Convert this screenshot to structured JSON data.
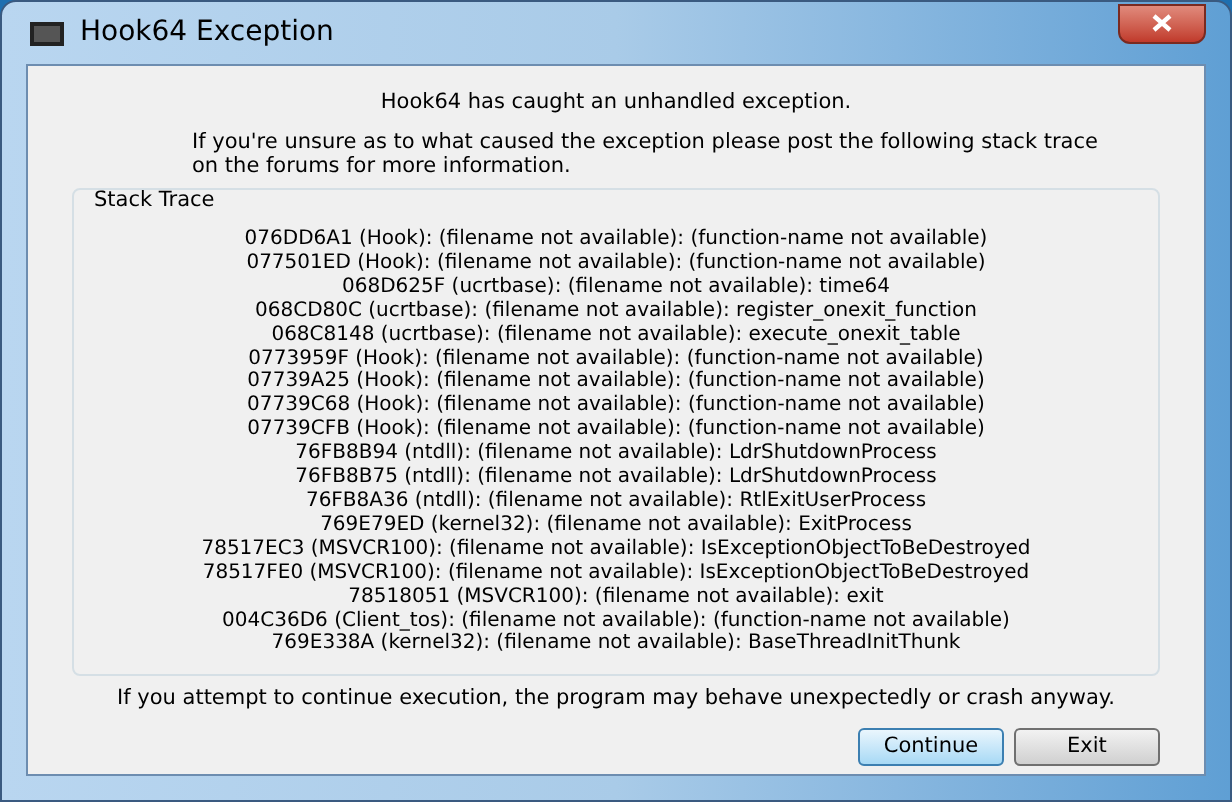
{
  "window": {
    "title": "Hook64 Exception"
  },
  "heading": "Hook64 has caught an unhandled exception.",
  "instructions": [
    "If you're unsure as to what caused the exception please post the following stack trace",
    "on the forums for more information."
  ],
  "stack_trace": {
    "label": "Stack Trace",
    "lines": [
      "076DD6A1 (Hook): (filename not available): (function-name not available)",
      "077501ED (Hook): (filename not available): (function-name not available)",
      "068D625F (ucrtbase): (filename not available): time64",
      "068CD80C (ucrtbase): (filename not available): register_onexit_function",
      "068C8148 (ucrtbase): (filename not available): execute_onexit_table",
      "0773959F (Hook): (filename not available): (function-name not available)",
      "07739A25 (Hook): (filename not available): (function-name not available)",
      "07739C68 (Hook): (filename not available): (function-name not available)",
      "07739CFB (Hook): (filename not available): (function-name not available)",
      "76FB8B94 (ntdll): (filename not available): LdrShutdownProcess",
      "76FB8B75 (ntdll): (filename not available): LdrShutdownProcess",
      "76FB8A36 (ntdll): (filename not available): RtlExitUserProcess",
      "769E79ED (kernel32): (filename not available): ExitProcess",
      "78517EC3 (MSVCR100): (filename not available): IsExceptionObjectToBeDestroyed",
      "78517FE0 (MSVCR100): (filename not available): IsExceptionObjectToBeDestroyed",
      "78518051 (MSVCR100): (filename not available): exit",
      "004C36D6 (Client_tos): (filename not available): (function-name not available)",
      "769E338A (kernel32): (filename not available): BaseThreadInitThunk"
    ]
  },
  "warning": "If you attempt to continue execution, the program may behave unexpectedly or crash anyway.",
  "buttons": [
    {
      "label": "Continue",
      "default": true
    },
    {
      "label": "Exit",
      "default": false
    }
  ]
}
